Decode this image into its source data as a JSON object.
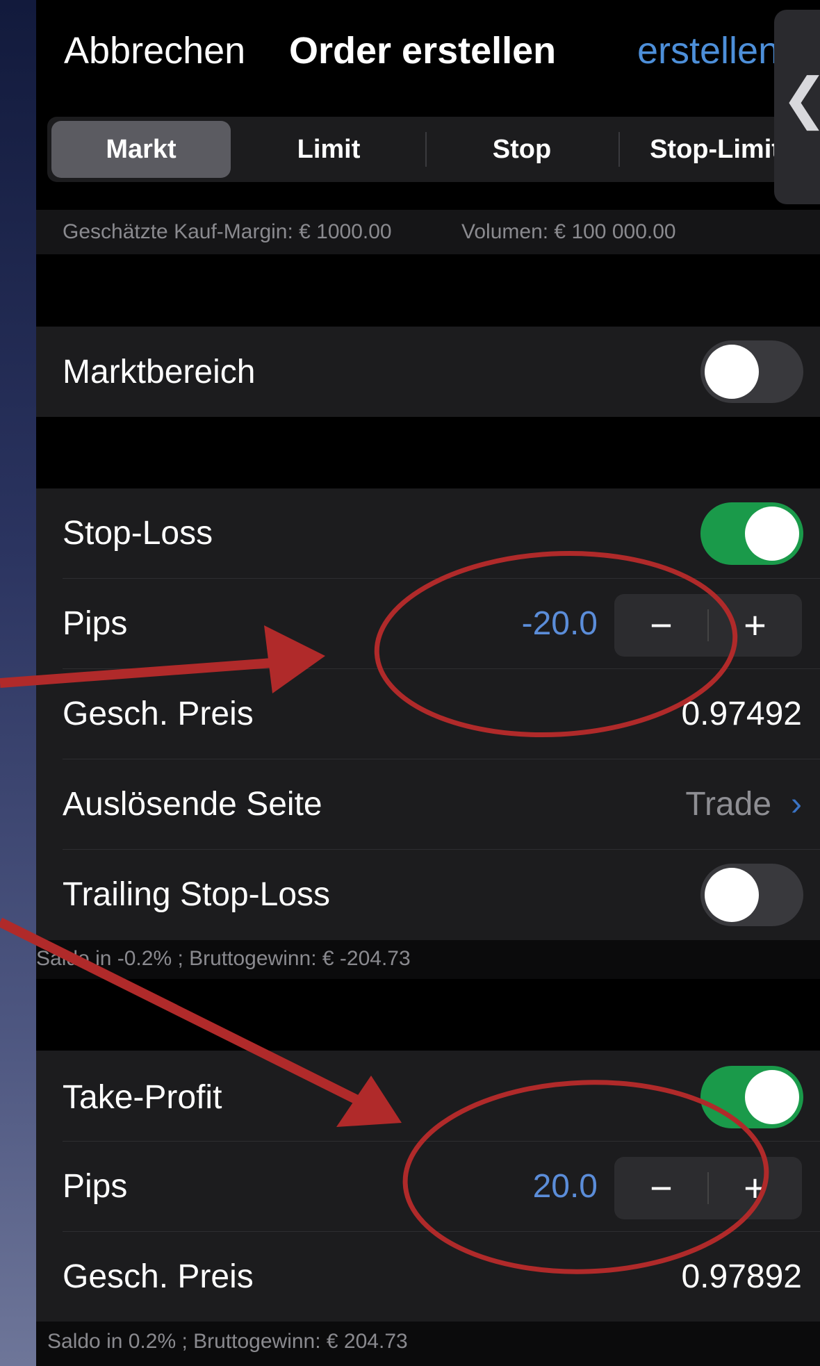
{
  "header": {
    "cancel_label": "Abbrechen",
    "title": "Order erstellen",
    "create_label": "erstellen"
  },
  "side_tab": {
    "chevron": "❮"
  },
  "order_types": [
    "Markt",
    "Limit",
    "Stop",
    "Stop-Limit"
  ],
  "selected_order_type": "Markt",
  "margin_info": {
    "margin": "Geschätzte Kauf-Margin: € 1000.00",
    "volume": "Volumen: € 100 000.00"
  },
  "market_range": {
    "label": "Marktbereich",
    "enabled": false
  },
  "stop_loss": {
    "label": "Stop-Loss",
    "enabled": true,
    "pips_label": "Pips",
    "pips_value": "-20.0",
    "est_price_label": "Gesch. Preis",
    "est_price_value": "0.97492",
    "trigger_side_label": "Auslösende Seite",
    "trigger_side_value": "Trade",
    "trailing_label": "Trailing Stop-Loss",
    "trailing_enabled": false,
    "summary": "Saldo in -0.2% ; Bruttogewinn: € -204.73"
  },
  "take_profit": {
    "label": "Take-Profit",
    "enabled": true,
    "pips_label": "Pips",
    "pips_value": "20.0",
    "est_price_label": "Gesch. Preis",
    "est_price_value": "0.97892",
    "summary": "Saldo in 0.2% ; Bruttogewinn: € 204.73"
  },
  "stepper": {
    "minus": "−",
    "plus": "+"
  },
  "annotation_color": "#b02a2a",
  "accent_color": "#4d8fd9",
  "toggle_on_color": "#1a9a4a"
}
